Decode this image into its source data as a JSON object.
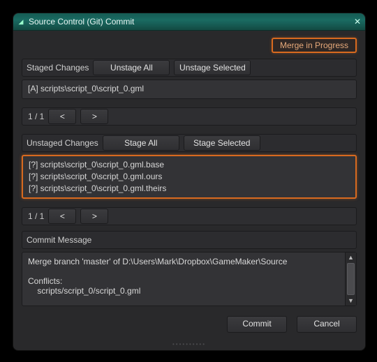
{
  "window": {
    "title": "Source Control (Git) Commit",
    "tri_icon": "◢",
    "close_icon": "✕"
  },
  "badge": {
    "merge_in_progress": "Merge in Progress"
  },
  "staged": {
    "label": "Staged Changes",
    "unstage_all": "Unstage All",
    "unstage_selected": "Unstage Selected",
    "items": [
      {
        "text": "[A] scripts\\script_0\\script_0.gml"
      }
    ],
    "pager": {
      "count": "1 / 1",
      "prev": "<",
      "next": ">"
    }
  },
  "unstaged": {
    "label": "Unstaged Changes",
    "stage_all": "Stage All",
    "stage_selected": "Stage Selected",
    "items": [
      {
        "text": "[?] scripts\\script_0\\script_0.gml.base"
      },
      {
        "text": "[?] scripts\\script_0\\script_0.gml.ours"
      },
      {
        "text": "[?] scripts\\script_0\\script_0.gml.theirs"
      }
    ],
    "pager": {
      "count": "1 / 1",
      "prev": "<",
      "next": ">"
    }
  },
  "commit_msg": {
    "label": "Commit Message",
    "text": "Merge branch 'master' of D:\\Users\\Mark\\Dropbox\\GameMaker\\Source\n\nConflicts:\n    scripts/script_0/script_0.gml"
  },
  "footer": {
    "commit": "Commit",
    "cancel": "Cancel"
  }
}
